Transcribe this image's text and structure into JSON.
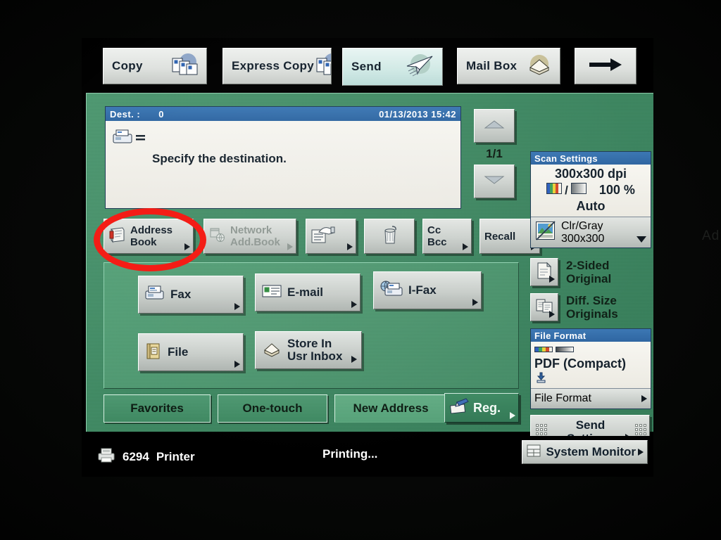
{
  "device": {
    "bezel_text": "Ad"
  },
  "tabs": [
    {
      "label": "Copy",
      "icon": "documents-icon",
      "selected": false
    },
    {
      "label": "Express Copy",
      "icon": "documents-icon",
      "selected": false
    },
    {
      "label": "Send",
      "icon": "paper-plane-icon",
      "selected": true
    },
    {
      "label": "Mail Box",
      "icon": "mailbox-tray-icon",
      "selected": false
    },
    {
      "label": "",
      "icon": "right-arrow-icon",
      "selected": false
    }
  ],
  "message_panel": {
    "dest_label": "Dest. :",
    "dest_count": "0",
    "datetime": "01/13/2013 15:42",
    "status_icon": "fax-equals-icon",
    "message": "Specify the destination."
  },
  "scroll": {
    "up_icon": "triangle-up-icon",
    "down_icon": "triangle-down-icon",
    "page_indicator": "1/1"
  },
  "action_buttons": [
    {
      "label": "Address\nBook",
      "icon": "address-book-icon",
      "arrow": "corner",
      "disabled": false,
      "name": "address-book-button"
    },
    {
      "label": "Network\nAdd.Book",
      "icon": "network-book-icon",
      "arrow": "corner",
      "disabled": true,
      "name": "network-address-book-button"
    },
    {
      "label": "",
      "icon": "hand-list-icon",
      "arrow": "corner",
      "disabled": false,
      "name": "previous-destination-button"
    },
    {
      "label": "",
      "icon": "trash-can-icon",
      "arrow": "none",
      "disabled": false,
      "name": "delete-destination-button"
    },
    {
      "label": "Cc\nBcc",
      "icon": "",
      "arrow": "corner",
      "disabled": false,
      "name": "cc-bcc-button"
    },
    {
      "label": "Recall",
      "icon": "",
      "arrow": "corner",
      "disabled": false,
      "name": "recall-button"
    }
  ],
  "destination_types": [
    {
      "label": "Fax",
      "icon": "fax-icon",
      "name": "fax-button"
    },
    {
      "label": "E-mail",
      "icon": "email-icon",
      "name": "email-button"
    },
    {
      "label": "I-Fax",
      "icon": "ifax-globe-icon",
      "name": "ifax-button"
    },
    {
      "label": "File",
      "icon": "file-folder-icon",
      "name": "file-button"
    },
    {
      "label": "Store In\nUsr Inbox",
      "icon": "inbox-store-icon",
      "name": "store-in-user-inbox-button"
    }
  ],
  "bottom_tabs": [
    {
      "label": "Favorites",
      "active": false,
      "name": "favorites-tab"
    },
    {
      "label": "One-touch",
      "active": false,
      "name": "one-touch-tab"
    },
    {
      "label": "New Address",
      "active": true,
      "name": "new-address-tab"
    }
  ],
  "reg_button": {
    "label": "Reg.",
    "icon": "pen-register-icon"
  },
  "sidebar": {
    "scan_settings": {
      "title": "Scan Settings",
      "resolution": "300x300 dpi",
      "color_icon": "color-gradient-icon",
      "gray_icon": "gray-gradient-icon",
      "zoom": "100 %",
      "size": "Auto",
      "mode_button": {
        "label": "Clr/Gray\n300x300",
        "icon": "color-photo-icon",
        "arrow": "dropdown"
      }
    },
    "original_options": [
      {
        "label": "2-Sided\nOriginal",
        "icon": "two-sided-page-icon",
        "name": "two-sided-original-button"
      },
      {
        "label": "Diff. Size\nOriginals",
        "icon": "different-size-pages-icon",
        "name": "different-size-originals-button"
      }
    ],
    "file_format": {
      "title": "File Format",
      "color_icon": "color-gradient-icon",
      "gray_icon": "gray-gradient-icon",
      "value": "PDF (Compact)",
      "compact_icon": "compress-down-icon",
      "button_label": "File Format"
    },
    "send_settings": {
      "label": "Send\nSettings",
      "icon": "dot-grid-icon"
    }
  },
  "status_bar": {
    "printer_icon": "printer-icon",
    "job_number": "6294",
    "job_type": "Printer",
    "status": "Printing...",
    "system_monitor": {
      "label": "System Monitor",
      "icon": "monitor-panes-icon"
    }
  },
  "annotation": {
    "shape": "ellipse",
    "color": "#f41d16",
    "target": "Address Book"
  },
  "colors": {
    "panel_green": "#3f8a63",
    "title_blue": "#2f66a2",
    "button_gray": "#cbd0cc",
    "annotation_red": "#f41d16"
  }
}
